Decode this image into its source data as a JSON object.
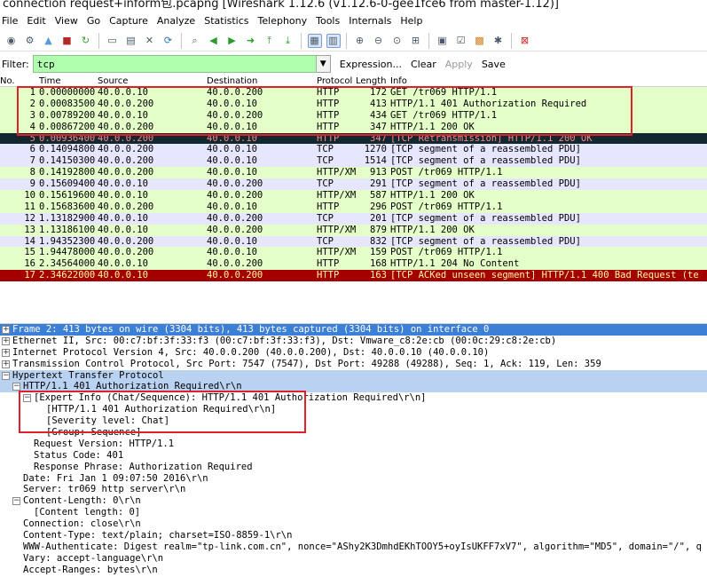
{
  "window": {
    "title": "connection request+inform包.pcapng   [Wireshark 1.12.6  (v1.12.6-0-gee1fce6 from master-1.12)]"
  },
  "menu": [
    "File",
    "Edit",
    "View",
    "Go",
    "Capture",
    "Analyze",
    "Statistics",
    "Telephony",
    "Tools",
    "Internals",
    "Help"
  ],
  "toolbar": [
    "interface-list-icon",
    "capture-options-icon",
    "start-capture-icon",
    "stop-capture-icon",
    "restart-capture-icon",
    "open-file-icon",
    "save-file-icon",
    "close-file-icon",
    "reload-icon",
    "find-packet-icon",
    "go-back-icon",
    "go-forward-icon",
    "go-to-packet-icon",
    "go-first-icon",
    "go-last-icon",
    "colorize-icon",
    "auto-scroll-icon",
    "zoom-in-icon",
    "zoom-out-icon",
    "normal-size-icon",
    "resize-columns-icon",
    "capture-filters-icon",
    "display-filters-icon",
    "coloring-rules-icon",
    "preferences-icon",
    "help-icon"
  ],
  "filter": {
    "label": "Filter:",
    "value": "tcp",
    "actions": [
      "Expression...",
      "Clear",
      "Apply",
      "Save"
    ]
  },
  "packet_list": {
    "columns": [
      "No.",
      "Time",
      "Source",
      "Destination",
      "Protocol",
      "Length",
      "Info"
    ],
    "rows": [
      {
        "no": "1",
        "time": "0.00000000",
        "src": "40.0.0.10",
        "dst": "40.0.0.200",
        "proto": "HTTP",
        "len": "172",
        "info": "GET /tr069 HTTP/1.1",
        "style": "http"
      },
      {
        "no": "2",
        "time": "0.00083500",
        "src": "40.0.0.200",
        "dst": "40.0.0.10",
        "proto": "HTTP",
        "len": "413",
        "info": "HTTP/1.1 401 Authorization Required",
        "style": "http"
      },
      {
        "no": "3",
        "time": "0.00789200",
        "src": "40.0.0.10",
        "dst": "40.0.0.200",
        "proto": "HTTP",
        "len": "434",
        "info": "GET /tr069 HTTP/1.1",
        "style": "http"
      },
      {
        "no": "4",
        "time": "0.00867200",
        "src": "40.0.0.200",
        "dst": "40.0.0.10",
        "proto": "HTTP",
        "len": "347",
        "info": "HTTP/1.1 200 OK",
        "style": "http"
      },
      {
        "no": "5",
        "time": "0.00936400",
        "src": "40.0.0.200",
        "dst": "40.0.0.10",
        "proto": "HTTP",
        "len": "347",
        "info": "[TCP Retransmission] HTTP/1.1 200 OK",
        "style": "retrans"
      },
      {
        "no": "6",
        "time": "0.14094800",
        "src": "40.0.0.200",
        "dst": "40.0.0.10",
        "proto": "TCP",
        "len": "1270",
        "info": "[TCP segment of a reassembled PDU]",
        "style": "tcp"
      },
      {
        "no": "7",
        "time": "0.14150300",
        "src": "40.0.0.200",
        "dst": "40.0.0.10",
        "proto": "TCP",
        "len": "1514",
        "info": "[TCP segment of a reassembled PDU]",
        "style": "tcp"
      },
      {
        "no": "8",
        "time": "0.14192800",
        "src": "40.0.0.200",
        "dst": "40.0.0.10",
        "proto": "HTTP/XM",
        "len": "913",
        "info": "POST /tr069 HTTP/1.1",
        "style": "http"
      },
      {
        "no": "9",
        "time": "0.15609400",
        "src": "40.0.0.10",
        "dst": "40.0.0.200",
        "proto": "TCP",
        "len": "291",
        "info": "[TCP segment of a reassembled PDU]",
        "style": "tcp"
      },
      {
        "no": "10",
        "time": "0.15619600",
        "src": "40.0.0.10",
        "dst": "40.0.0.200",
        "proto": "HTTP/XM",
        "len": "587",
        "info": "HTTP/1.1 200 OK",
        "style": "http"
      },
      {
        "no": "11",
        "time": "0.15683600",
        "src": "40.0.0.200",
        "dst": "40.0.0.10",
        "proto": "HTTP",
        "len": "296",
        "info": "POST /tr069 HTTP/1.1",
        "style": "http"
      },
      {
        "no": "12",
        "time": "1.13182900",
        "src": "40.0.0.10",
        "dst": "40.0.0.200",
        "proto": "TCP",
        "len": "201",
        "info": "[TCP segment of a reassembled PDU]",
        "style": "tcp"
      },
      {
        "no": "13",
        "time": "1.13186100",
        "src": "40.0.0.10",
        "dst": "40.0.0.200",
        "proto": "HTTP/XM",
        "len": "879",
        "info": "HTTP/1.1 200 OK",
        "style": "http"
      },
      {
        "no": "14",
        "time": "1.94352300",
        "src": "40.0.0.200",
        "dst": "40.0.0.10",
        "proto": "TCP",
        "len": "832",
        "info": "[TCP segment of a reassembled PDU]",
        "style": "tcp"
      },
      {
        "no": "15",
        "time": "1.94478000",
        "src": "40.0.0.200",
        "dst": "40.0.0.10",
        "proto": "HTTP/XM",
        "len": "159",
        "info": "POST /tr069 HTTP/1.1",
        "style": "http"
      },
      {
        "no": "16",
        "time": "2.34564000",
        "src": "40.0.0.10",
        "dst": "40.0.0.200",
        "proto": "HTTP",
        "len": "168",
        "info": "HTTP/1.1 204 No Content",
        "style": "http"
      },
      {
        "no": "17",
        "time": "2.34622000",
        "src": "40.0.0.10",
        "dst": "40.0.0.200",
        "proto": "HTTP",
        "len": "163",
        "info": "[TCP ACKed unseen segment] HTTP/1.1 400 Bad Request  (te",
        "style": "acked"
      }
    ]
  },
  "detail_pane": {
    "rows": [
      {
        "indent": 0,
        "expander": "+",
        "text": "Frame 2: 413 bytes on wire (3304 bits), 413 bytes captured (3304 bits) on interface 0",
        "style": "blue"
      },
      {
        "indent": 0,
        "expander": "+",
        "text": "Ethernet II, Src: 00:c7:bf:3f:33:f3 (00:c7:bf:3f:33:f3), Dst: Vmware_c8:2e:cb (00:0c:29:c8:2e:cb)",
        "style": ""
      },
      {
        "indent": 0,
        "expander": "+",
        "text": "Internet Protocol Version 4, Src: 40.0.0.200 (40.0.0.200), Dst: 40.0.0.10 (40.0.0.10)",
        "style": ""
      },
      {
        "indent": 0,
        "expander": "+",
        "text": "Transmission Control Protocol, Src Port: 7547 (7547), Dst Port: 49288 (49288), Seq: 1, Ack: 119, Len: 359",
        "style": ""
      },
      {
        "indent": 0,
        "expander": "-",
        "text": "Hypertext Transfer Protocol",
        "style": "light"
      },
      {
        "indent": 1,
        "expander": "-",
        "text": "HTTP/1.1 401 Authorization Required\\r\\n",
        "style": "light"
      },
      {
        "indent": 2,
        "expander": "-",
        "text": "[Expert Info (Chat/Sequence): HTTP/1.1 401 Authorization Required\\r\\n]",
        "style": ""
      },
      {
        "indent": 3,
        "expander": "",
        "text": "[HTTP/1.1 401 Authorization Required\\r\\n]",
        "style": ""
      },
      {
        "indent": 3,
        "expander": "",
        "text": "[Severity level: Chat]",
        "style": ""
      },
      {
        "indent": 3,
        "expander": "",
        "text": "[Group: Sequence]",
        "style": ""
      },
      {
        "indent": 2,
        "expander": "",
        "text": "Request Version: HTTP/1.1",
        "style": ""
      },
      {
        "indent": 2,
        "expander": "",
        "text": "Status Code: 401",
        "style": ""
      },
      {
        "indent": 2,
        "expander": "",
        "text": "Response Phrase: Authorization Required",
        "style": ""
      },
      {
        "indent": 1,
        "expander": "",
        "text": "Date: Fri Jan  1 09:07:50 2016\\r\\n",
        "style": ""
      },
      {
        "indent": 1,
        "expander": "",
        "text": "Server: tr069 http server\\r\\n",
        "style": ""
      },
      {
        "indent": 1,
        "expander": "-",
        "text": "Content-Length: 0\\r\\n",
        "style": ""
      },
      {
        "indent": 2,
        "expander": "",
        "text": "[Content length: 0]",
        "style": ""
      },
      {
        "indent": 1,
        "expander": "",
        "text": "Connection: close\\r\\n",
        "style": ""
      },
      {
        "indent": 1,
        "expander": "",
        "text": "Content-Type: text/plain; charset=ISO-8859-1\\r\\n",
        "style": ""
      },
      {
        "indent": 1,
        "expander": "",
        "text": "WWW-Authenticate: Digest realm=\"tp-link.com.cn\", nonce=\"AShy2K3DmhdEKhTOOY5+oyIsUKFF7xV7\", algorithm=\"MD5\", domain=\"/\", q",
        "style": ""
      },
      {
        "indent": 1,
        "expander": "",
        "text": "Vary: accept-language\\r\\n",
        "style": ""
      },
      {
        "indent": 1,
        "expander": "",
        "text": "Accept-Ranges: bytes\\r\\n",
        "style": ""
      },
      {
        "indent": 1,
        "expander": "",
        "text": "\\r\\n",
        "style": ""
      }
    ]
  },
  "colors": {
    "http_row": "#e4ffc7",
    "tcp_row": "#e7e6ff",
    "retransmission_row": "#12272e",
    "acked_unseen_row": "#a40000",
    "filter_valid": "#afffaf",
    "selection": "#3b7fd6",
    "annotation_box": "#e0202a"
  }
}
